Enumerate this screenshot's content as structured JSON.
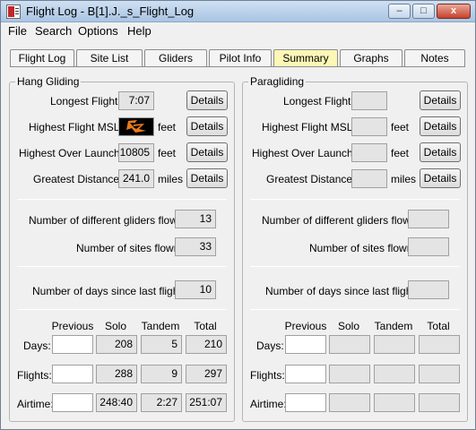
{
  "window": {
    "title": "Flight Log - B[1].J._s_Flight_Log",
    "controls": {
      "minimize": "–",
      "maximize": "□",
      "close": "x"
    }
  },
  "menu": [
    "File",
    "Search",
    "Options",
    "Help"
  ],
  "tabs": [
    {
      "label": "Flight Log"
    },
    {
      "label": "Site List"
    },
    {
      "label": "Gliders"
    },
    {
      "label": "Pilot Info"
    },
    {
      "label": "Summary",
      "active": true
    },
    {
      "label": "Graphs"
    },
    {
      "label": "Notes"
    }
  ],
  "hang_gliding": {
    "title": "Hang Gliding",
    "longest_flight": {
      "label": "Longest Flight:",
      "value": "7:07",
      "button": "Details"
    },
    "highest_msl": {
      "label": "Highest Flight MSL:",
      "value": "",
      "unit": "feet",
      "button": "Details"
    },
    "highest_over_launch": {
      "label": "Highest Over Launch:",
      "value": "10805",
      "unit": "feet",
      "button": "Details"
    },
    "greatest_distance": {
      "label": "Greatest Distance:",
      "value": "241.0",
      "unit": "miles",
      "button": "Details"
    },
    "gliders_flown": {
      "label": "Number of different gliders flown:",
      "value": "13"
    },
    "sites_flown": {
      "label": "Number of sites flown:",
      "value": "33"
    },
    "days_since": {
      "label": "Number of days since last flight:",
      "value": "10"
    },
    "table": {
      "headers": [
        "Previous",
        "Solo",
        "Tandem",
        "Total"
      ],
      "rows": [
        {
          "label": "Days:",
          "previous": "",
          "solo": "208",
          "tandem": "5",
          "total": "210"
        },
        {
          "label": "Flights:",
          "previous": "",
          "solo": "288",
          "tandem": "9",
          "total": "297"
        },
        {
          "label": "Airtime:",
          "previous": "",
          "solo": "248:40",
          "tandem": "2:27",
          "total": "251:07"
        }
      ]
    }
  },
  "paragliding": {
    "title": "Paragliding",
    "longest_flight": {
      "label": "Longest Flight:",
      "value": "",
      "button": "Details"
    },
    "highest_msl": {
      "label": "Highest Flight MSL:",
      "value": "",
      "unit": "feet",
      "button": "Details"
    },
    "highest_over_launch": {
      "label": "Highest Over Launch:",
      "value": "",
      "unit": "feet",
      "button": "Details"
    },
    "greatest_distance": {
      "label": "Greatest Distance:",
      "value": "",
      "unit": "miles",
      "button": "Details"
    },
    "gliders_flown": {
      "label": "Number of different gliders flown:",
      "value": ""
    },
    "sites_flown": {
      "label": "Number of sites flown:",
      "value": ""
    },
    "days_since": {
      "label": "Number of days since last flight:",
      "value": ""
    },
    "table": {
      "headers": [
        "Previous",
        "Solo",
        "Tandem",
        "Total"
      ],
      "rows": [
        {
          "label": "Days:",
          "previous": "",
          "solo": "",
          "tandem": "",
          "total": ""
        },
        {
          "label": "Flights:",
          "previous": "",
          "solo": "",
          "tandem": "",
          "total": ""
        },
        {
          "label": "Airtime:",
          "previous": "",
          "solo": "",
          "tandem": "",
          "total": ""
        }
      ]
    }
  },
  "colors": {
    "active_tab": "#fdf7b6",
    "field_bg": "#e4e4e4",
    "window_bg": "#f0f0f0"
  }
}
